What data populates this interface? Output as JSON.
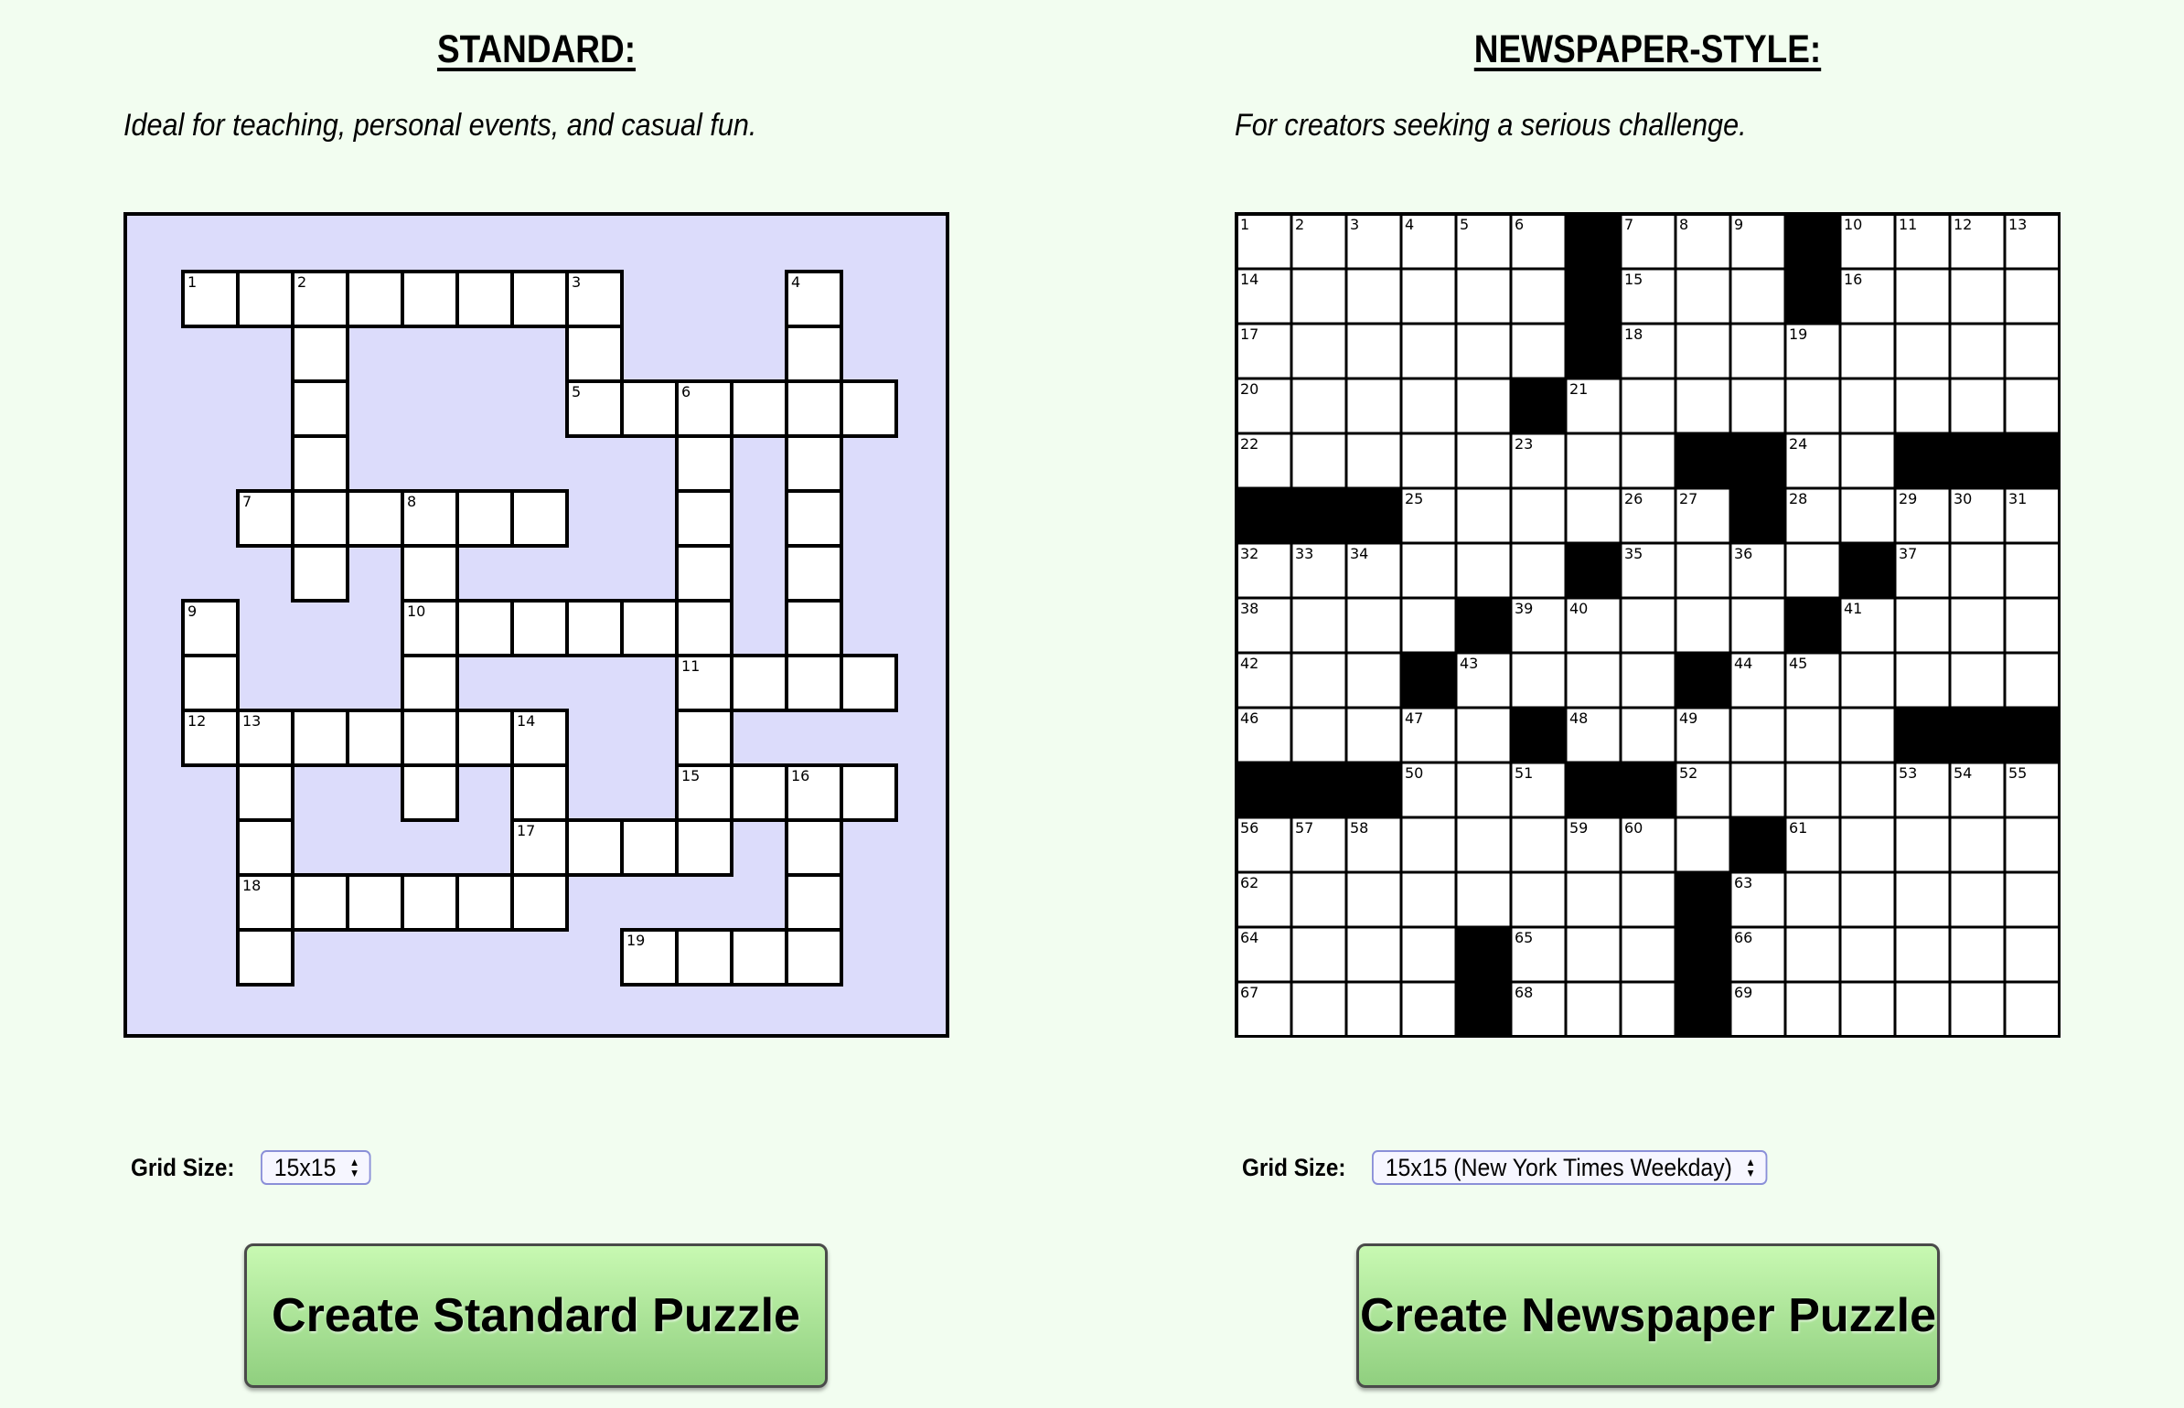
{
  "standard": {
    "heading": "STANDARD:",
    "tagline": "Ideal for teaching, personal events, and casual fun.",
    "grid_size_label": "Grid Size:",
    "grid_size_value": "15x15",
    "create_button": "Create Standard Puzzle",
    "grid_background": "#dcdcfb",
    "cells": [
      [
        1,
        1,
        "1"
      ],
      [
        2,
        1,
        ""
      ],
      [
        3,
        1,
        "2"
      ],
      [
        4,
        1,
        ""
      ],
      [
        5,
        1,
        ""
      ],
      [
        6,
        1,
        ""
      ],
      [
        7,
        1,
        ""
      ],
      [
        8,
        1,
        "3"
      ],
      [
        12,
        1,
        "4"
      ],
      [
        3,
        2,
        ""
      ],
      [
        8,
        2,
        ""
      ],
      [
        12,
        2,
        ""
      ],
      [
        3,
        3,
        ""
      ],
      [
        8,
        3,
        "5"
      ],
      [
        9,
        3,
        ""
      ],
      [
        10,
        3,
        "6"
      ],
      [
        11,
        3,
        ""
      ],
      [
        12,
        3,
        ""
      ],
      [
        13,
        3,
        ""
      ],
      [
        3,
        4,
        ""
      ],
      [
        10,
        4,
        ""
      ],
      [
        12,
        4,
        ""
      ],
      [
        2,
        5,
        "7"
      ],
      [
        3,
        5,
        ""
      ],
      [
        4,
        5,
        ""
      ],
      [
        5,
        5,
        "8"
      ],
      [
        6,
        5,
        ""
      ],
      [
        7,
        5,
        ""
      ],
      [
        10,
        5,
        ""
      ],
      [
        12,
        5,
        ""
      ],
      [
        3,
        6,
        ""
      ],
      [
        5,
        6,
        ""
      ],
      [
        10,
        6,
        ""
      ],
      [
        12,
        6,
        ""
      ],
      [
        1,
        7,
        "9"
      ],
      [
        5,
        7,
        "10"
      ],
      [
        6,
        7,
        ""
      ],
      [
        7,
        7,
        ""
      ],
      [
        8,
        7,
        ""
      ],
      [
        9,
        7,
        ""
      ],
      [
        10,
        7,
        ""
      ],
      [
        12,
        7,
        ""
      ],
      [
        1,
        8,
        ""
      ],
      [
        5,
        8,
        ""
      ],
      [
        10,
        8,
        "11"
      ],
      [
        11,
        8,
        ""
      ],
      [
        12,
        8,
        ""
      ],
      [
        13,
        8,
        ""
      ],
      [
        1,
        9,
        "12"
      ],
      [
        2,
        9,
        "13"
      ],
      [
        3,
        9,
        ""
      ],
      [
        4,
        9,
        ""
      ],
      [
        5,
        9,
        ""
      ],
      [
        6,
        9,
        ""
      ],
      [
        7,
        9,
        "14"
      ],
      [
        10,
        9,
        ""
      ],
      [
        2,
        10,
        ""
      ],
      [
        5,
        10,
        ""
      ],
      [
        7,
        10,
        ""
      ],
      [
        10,
        10,
        "15"
      ],
      [
        11,
        10,
        ""
      ],
      [
        12,
        10,
        "16"
      ],
      [
        13,
        10,
        ""
      ],
      [
        2,
        11,
        ""
      ],
      [
        7,
        11,
        "17"
      ],
      [
        8,
        11,
        ""
      ],
      [
        9,
        11,
        ""
      ],
      [
        10,
        11,
        ""
      ],
      [
        12,
        11,
        ""
      ],
      [
        2,
        12,
        "18"
      ],
      [
        3,
        12,
        ""
      ],
      [
        4,
        12,
        ""
      ],
      [
        5,
        12,
        ""
      ],
      [
        6,
        12,
        ""
      ],
      [
        7,
        12,
        ""
      ],
      [
        12,
        12,
        ""
      ],
      [
        2,
        13,
        ""
      ],
      [
        9,
        13,
        "19"
      ],
      [
        10,
        13,
        ""
      ],
      [
        11,
        13,
        ""
      ],
      [
        12,
        13,
        ""
      ]
    ]
  },
  "newspaper": {
    "heading": "NEWSPAPER-STYLE:",
    "tagline": "For creators seeking a serious challenge.",
    "grid_size_label": "Grid Size:",
    "grid_size_value": "15x15 (New York Times Weekday)",
    "create_button": "Create Newspaper Puzzle",
    "black_cells": [
      [
        0,
        6
      ],
      [
        0,
        10
      ],
      [
        1,
        6
      ],
      [
        1,
        10
      ],
      [
        2,
        6
      ],
      [
        3,
        5
      ],
      [
        4,
        8
      ],
      [
        4,
        9
      ],
      [
        4,
        12
      ],
      [
        4,
        13
      ],
      [
        4,
        14
      ],
      [
        5,
        0
      ],
      [
        5,
        1
      ],
      [
        5,
        2
      ],
      [
        5,
        9
      ],
      [
        6,
        6
      ],
      [
        6,
        11
      ],
      [
        7,
        4
      ],
      [
        7,
        10
      ],
      [
        8,
        3
      ],
      [
        8,
        8
      ],
      [
        9,
        5
      ],
      [
        9,
        12
      ],
      [
        9,
        13
      ],
      [
        9,
        14
      ],
      [
        10,
        0
      ],
      [
        10,
        1
      ],
      [
        10,
        2
      ],
      [
        10,
        6
      ],
      [
        10,
        7
      ],
      [
        11,
        9
      ],
      [
        12,
        8
      ],
      [
        13,
        4
      ],
      [
        13,
        8
      ],
      [
        14,
        4
      ],
      [
        14,
        8
      ]
    ],
    "numbers": [
      [
        0,
        0,
        "1"
      ],
      [
        0,
        1,
        "2"
      ],
      [
        0,
        2,
        "3"
      ],
      [
        0,
        3,
        "4"
      ],
      [
        0,
        4,
        "5"
      ],
      [
        0,
        5,
        "6"
      ],
      [
        0,
        7,
        "7"
      ],
      [
        0,
        8,
        "8"
      ],
      [
        0,
        9,
        "9"
      ],
      [
        0,
        11,
        "10"
      ],
      [
        0,
        12,
        "11"
      ],
      [
        0,
        13,
        "12"
      ],
      [
        0,
        14,
        "13"
      ],
      [
        1,
        0,
        "14"
      ],
      [
        1,
        7,
        "15"
      ],
      [
        1,
        11,
        "16"
      ],
      [
        2,
        0,
        "17"
      ],
      [
        2,
        7,
        "18"
      ],
      [
        2,
        10,
        "19"
      ],
      [
        3,
        0,
        "20"
      ],
      [
        3,
        6,
        "21"
      ],
      [
        4,
        0,
        "22"
      ],
      [
        4,
        5,
        "23"
      ],
      [
        4,
        10,
        "24"
      ],
      [
        5,
        3,
        "25"
      ],
      [
        5,
        7,
        "26"
      ],
      [
        5,
        8,
        "27"
      ],
      [
        5,
        10,
        "28"
      ],
      [
        5,
        12,
        "29"
      ],
      [
        5,
        13,
        "30"
      ],
      [
        5,
        14,
        "31"
      ],
      [
        6,
        0,
        "32"
      ],
      [
        6,
        1,
        "33"
      ],
      [
        6,
        2,
        "34"
      ],
      [
        6,
        7,
        "35"
      ],
      [
        6,
        9,
        "36"
      ],
      [
        6,
        12,
        "37"
      ],
      [
        7,
        0,
        "38"
      ],
      [
        7,
        5,
        "39"
      ],
      [
        7,
        6,
        "40"
      ],
      [
        7,
        11,
        "41"
      ],
      [
        8,
        0,
        "42"
      ],
      [
        8,
        4,
        "43"
      ],
      [
        8,
        9,
        "44"
      ],
      [
        8,
        10,
        "45"
      ],
      [
        9,
        0,
        "46"
      ],
      [
        9,
        3,
        "47"
      ],
      [
        9,
        6,
        "48"
      ],
      [
        9,
        8,
        "49"
      ],
      [
        10,
        3,
        "50"
      ],
      [
        10,
        5,
        "51"
      ],
      [
        10,
        8,
        "52"
      ],
      [
        10,
        12,
        "53"
      ],
      [
        10,
        13,
        "54"
      ],
      [
        10,
        14,
        "55"
      ],
      [
        11,
        0,
        "56"
      ],
      [
        11,
        1,
        "57"
      ],
      [
        11,
        2,
        "58"
      ],
      [
        11,
        6,
        "59"
      ],
      [
        11,
        7,
        "60"
      ],
      [
        11,
        10,
        "61"
      ],
      [
        12,
        0,
        "62"
      ],
      [
        12,
        9,
        "63"
      ],
      [
        13,
        0,
        "64"
      ],
      [
        13,
        5,
        "65"
      ],
      [
        13,
        9,
        "66"
      ],
      [
        14,
        0,
        "67"
      ],
      [
        14,
        5,
        "68"
      ],
      [
        14,
        9,
        "69"
      ]
    ]
  }
}
